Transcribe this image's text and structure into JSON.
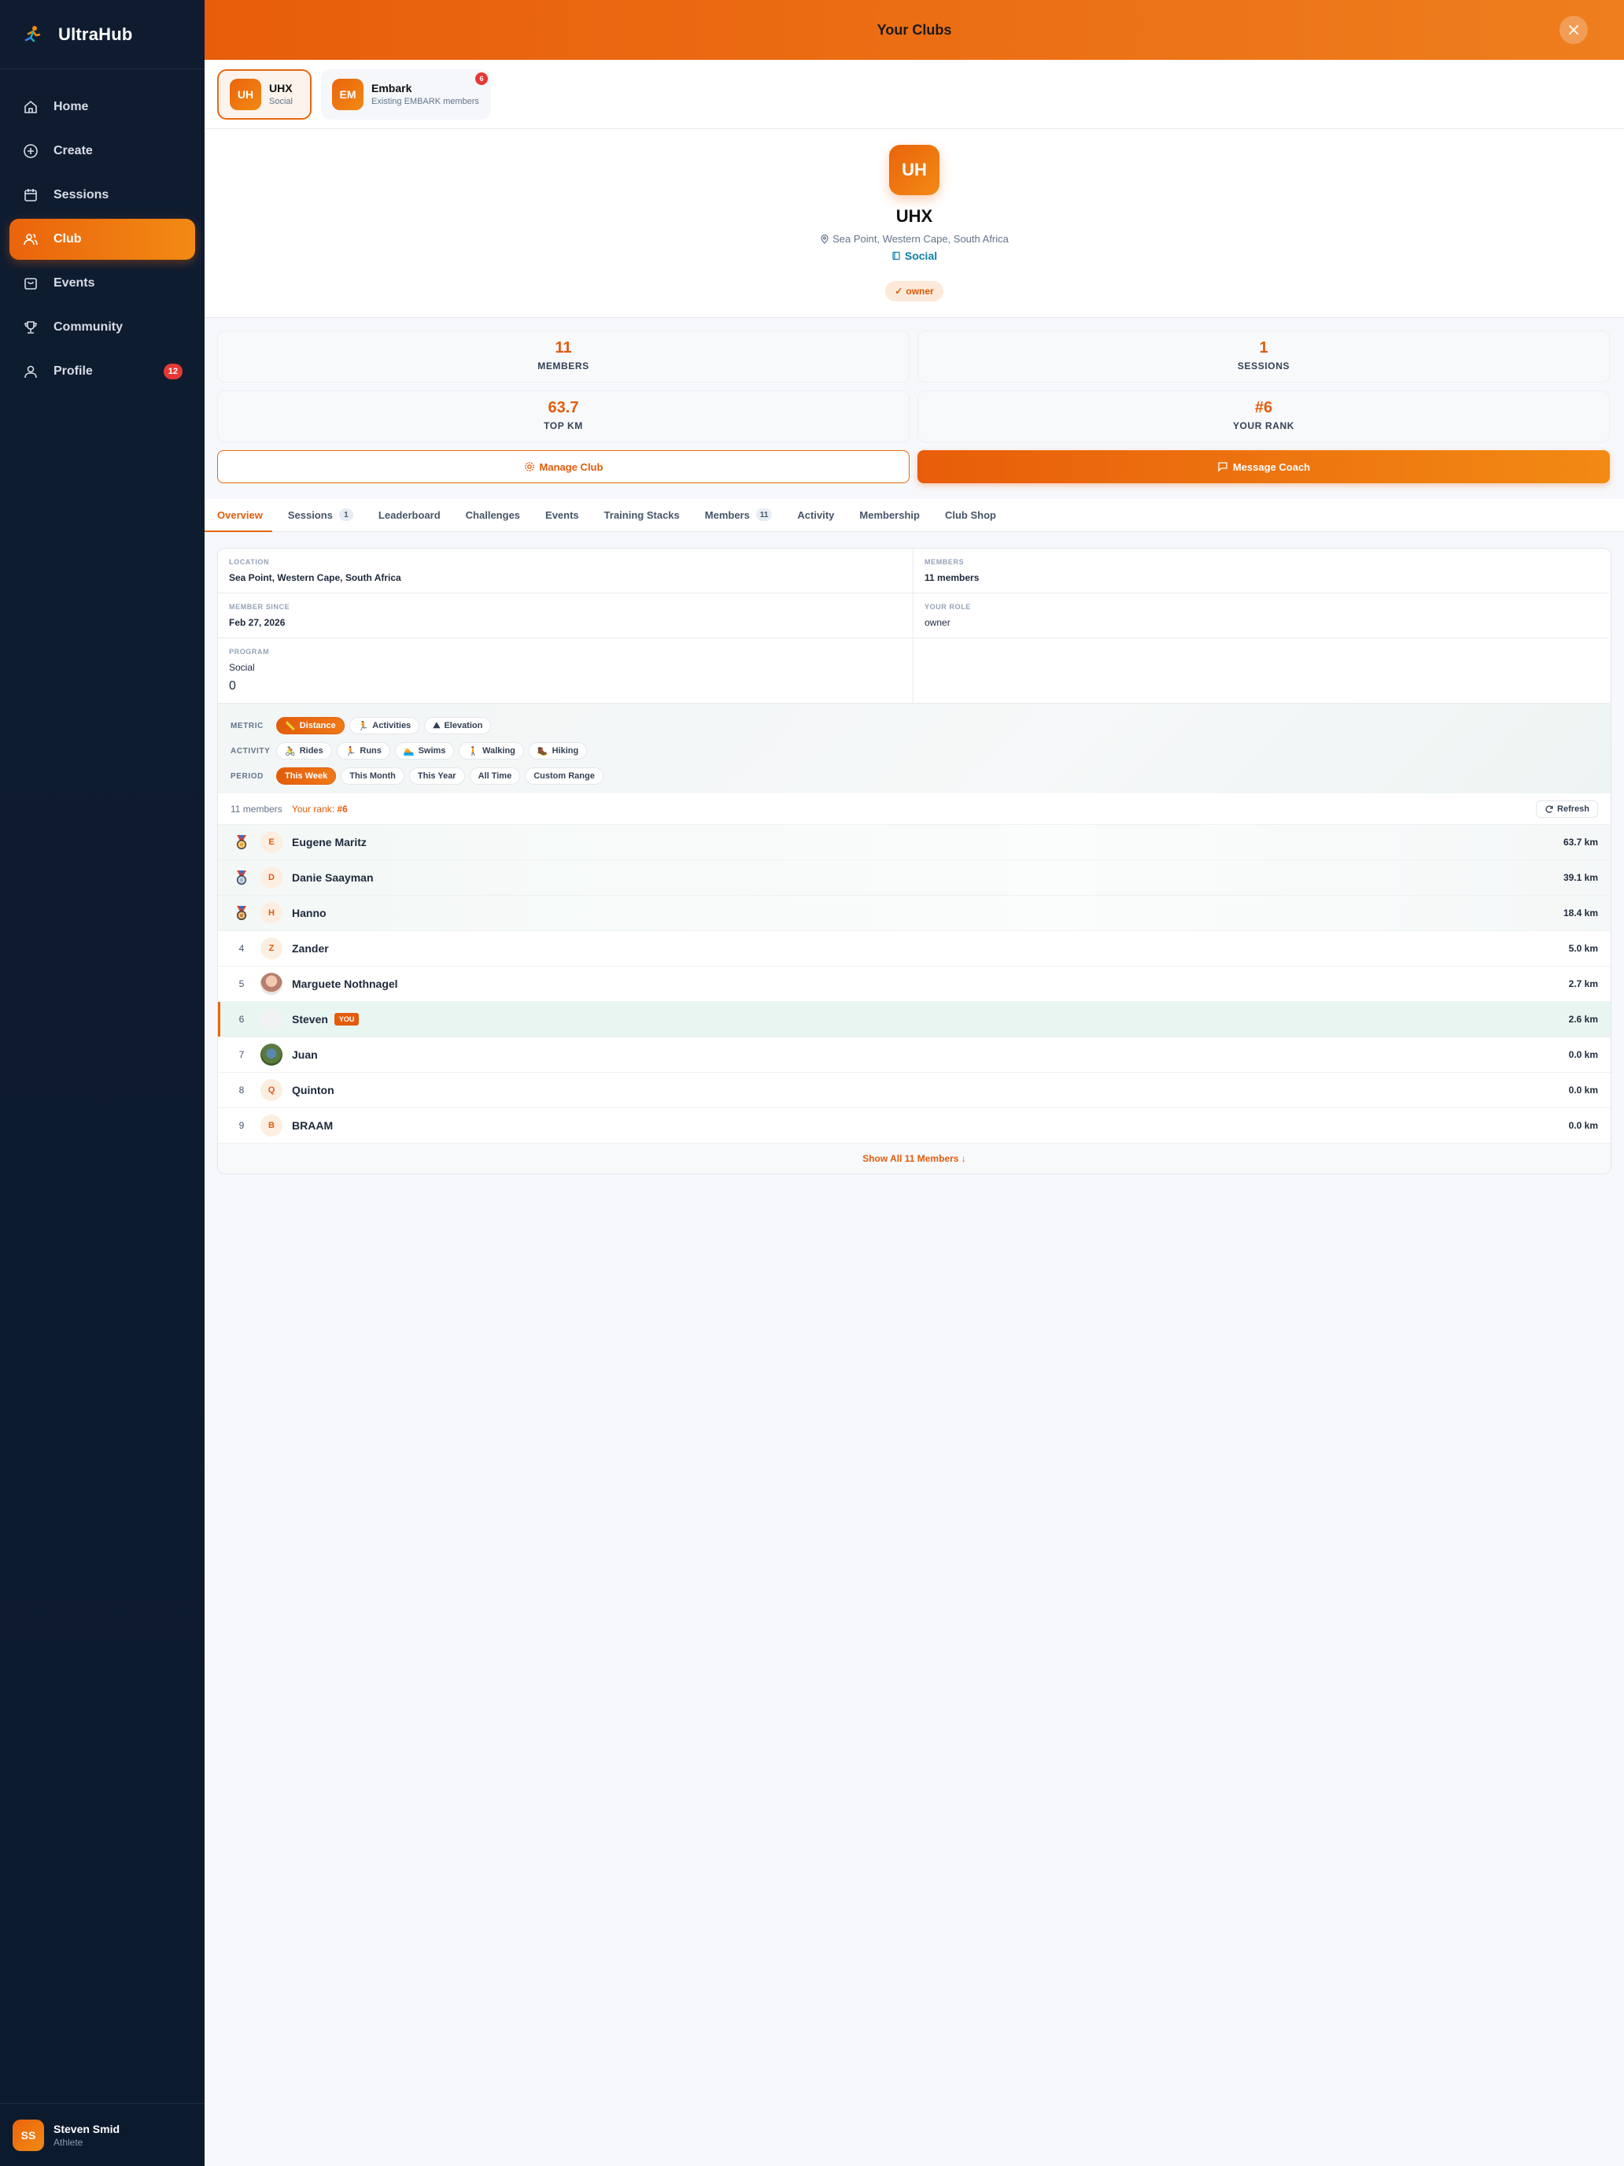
{
  "app": {
    "name": "UltraHub"
  },
  "nav": [
    {
      "label": "Home",
      "icon": "home-icon"
    },
    {
      "label": "Create",
      "icon": "plus-circle-icon"
    },
    {
      "label": "Sessions",
      "icon": "calendar-icon"
    },
    {
      "label": "Club",
      "icon": "users-icon",
      "active": true
    },
    {
      "label": "Events",
      "icon": "bag-icon"
    },
    {
      "label": "Community",
      "icon": "trophy-icon"
    },
    {
      "label": "Profile",
      "icon": "user-icon",
      "badge": "12"
    }
  ],
  "user": {
    "initials": "SS",
    "name": "Steven Smid",
    "role": "Athlete"
  },
  "header": {
    "title": "Your Clubs"
  },
  "clubs": [
    {
      "initials": "UH",
      "name": "UHX",
      "sub": "Social",
      "active": true
    },
    {
      "initials": "EM",
      "name": "Embark",
      "sub": "Existing EMBARK members",
      "badge": "6"
    }
  ],
  "club": {
    "initials": "UH",
    "name": "UHX",
    "location": "Sea Point, Western Cape, South Africa",
    "program": "Social",
    "role": "owner"
  },
  "stats": [
    {
      "value": "11",
      "label": "MEMBERS"
    },
    {
      "value": "1",
      "label": "SESSIONS"
    },
    {
      "value": "63.7",
      "label": "TOP KM"
    },
    {
      "value": "#6",
      "label": "YOUR RANK"
    }
  ],
  "actions": {
    "manage": "Manage Club",
    "message": "Message Coach"
  },
  "tabs": [
    {
      "label": "Overview",
      "active": true
    },
    {
      "label": "Sessions",
      "count": "1"
    },
    {
      "label": "Leaderboard"
    },
    {
      "label": "Challenges"
    },
    {
      "label": "Events"
    },
    {
      "label": "Training Stacks"
    },
    {
      "label": "Members",
      "count": "11"
    },
    {
      "label": "Activity"
    },
    {
      "label": "Membership"
    },
    {
      "label": "Club Shop"
    }
  ],
  "info": {
    "location_label": "LOCATION",
    "location": "Sea Point, Western Cape, South Africa",
    "members_label": "MEMBERS",
    "members": "11 members",
    "since_label": "MEMBER SINCE",
    "since": "Feb 27, 2026",
    "role_label": "YOUR ROLE",
    "role": "owner",
    "program_label": "PROGRAM",
    "program": "Social",
    "program_extra": "0"
  },
  "filters": {
    "metric_label": "METRIC",
    "metric": [
      {
        "label": "Distance",
        "glyph": "📏",
        "on": true
      },
      {
        "label": "Activities",
        "glyph": "🏃"
      },
      {
        "label": "Elevation",
        "glyph": "⛰"
      }
    ],
    "activity_label": "ACTIVITY",
    "activity": [
      {
        "label": "Rides",
        "glyph": "🚴"
      },
      {
        "label": "Runs",
        "glyph": "🏃"
      },
      {
        "label": "Swims",
        "glyph": "🏊"
      },
      {
        "label": "Walking",
        "glyph": "🚶"
      },
      {
        "label": "Hiking",
        "glyph": "🥾"
      }
    ],
    "period_label": "PERIOD",
    "period": [
      {
        "label": "This Week",
        "on": true
      },
      {
        "label": "This Month"
      },
      {
        "label": "This Year"
      },
      {
        "label": "All Time"
      },
      {
        "label": "Custom Range"
      }
    ]
  },
  "leaderboard": {
    "count": "11 members",
    "rank_label": "Your rank:",
    "rank": "#6",
    "refresh": "Refresh",
    "rows": [
      {
        "pos": "1",
        "medal": "gold",
        "initial": "E",
        "name": "Eugene Maritz",
        "km": "63.7 km"
      },
      {
        "pos": "2",
        "medal": "silver",
        "initial": "D",
        "name": "Danie Saayman",
        "km": "39.1 km"
      },
      {
        "pos": "3",
        "medal": "bronze",
        "initial": "H",
        "name": "Hanno",
        "km": "18.4 km"
      },
      {
        "pos": "4",
        "initial": "Z",
        "name": "Zander",
        "km": "5.0 km"
      },
      {
        "pos": "5",
        "photo": "photo1",
        "name": "Marguete Nothnagel",
        "km": "2.7 km"
      },
      {
        "pos": "6",
        "photo": "photo2",
        "name": "Steven",
        "km": "2.6 km",
        "me": true,
        "you": "YOU"
      },
      {
        "pos": "7",
        "photo": "photo3",
        "name": "Juan",
        "km": "0.0 km"
      },
      {
        "pos": "8",
        "initial": "Q",
        "name": "Quinton",
        "km": "0.0 km"
      },
      {
        "pos": "9",
        "initial": "B",
        "name": "BRAAM",
        "km": "0.0 km"
      }
    ],
    "show_all": "Show All 11 Members ↓"
  },
  "colors": {
    "accent": "#e8670e",
    "sidebar": "#0f1c30",
    "link": "#0e7fa6"
  }
}
